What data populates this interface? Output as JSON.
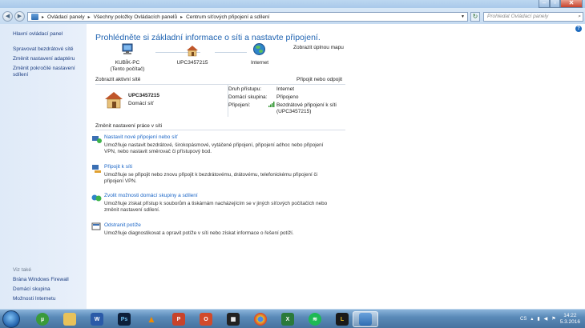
{
  "breadcrumb": [
    "Ovládací panely",
    "Všechny položky Ovládacích panelů",
    "Centrum síťových připojení a sdílení"
  ],
  "search_placeholder": "Prohledat Ovládací panely",
  "sidebar": {
    "items": [
      "Hlavní ovládací panel",
      "Spravovat bezdrátové sítě",
      "Změnit nastavení adaptéru",
      "Změnit pokročilé nastavení",
      "sdílení"
    ],
    "see_also": "Viz také",
    "see_links": [
      "Brána Windows Firewall",
      "Domácí skupina",
      "Možnosti Internetu"
    ]
  },
  "main": {
    "heading": "Prohlédněte si základní informace o síti a nastavte připojení.",
    "full_map": "Zobrazit úplnou mapu",
    "nodes": [
      {
        "label": "KUBÍK-PC",
        "sub": "(Tento počítač)"
      },
      {
        "label": "UPC3457215",
        "sub": ""
      },
      {
        "label": "Internet",
        "sub": ""
      }
    ],
    "active_title": "Zobrazit aktivní sítě",
    "connect_link": "Připojit nebo odpojit",
    "network_name": "UPC3457215",
    "network_type": "Domácí síť",
    "access_label": "Druh přístupu:",
    "access_value": "Internet",
    "homegroup_label": "Domácí skupina:",
    "homegroup_value": "Připojeno",
    "connections_label": "Připojení:",
    "connections_value1": "Bezdrátové připojení k síti",
    "connections_value2": "(UPC3457215)",
    "change_title": "Změnit nastavení práce v síti",
    "tasks": [
      {
        "title": "Nastavit nové připojení nebo síť",
        "desc1": "Umožňuje nastavit bezdrátové, širokopásmové, vytáčené připojení, připojení adhoc nebo připojení",
        "desc2": "VPN, nebo nastavit směrovač či přístupový bod."
      },
      {
        "title": "Připojit k síti",
        "desc1": "Umožňuje se připojit nebo znovu připojit k bezdrátovému, drátovému, telefonickému připojení či",
        "desc2": "připojení VPN."
      },
      {
        "title": "Zvolit možnosti domácí skupiny a sdílení",
        "desc1": "Umožňuje získat přístup k souborům a tiskárnám nacházejícím se v jiných síťových počítačích nebo",
        "desc2": "změnit nastavení sdílení."
      },
      {
        "title": "Odstranit potíže",
        "desc1": "Umožňuje diagnostikovat a opravit potíže v síti nebo získat informace o řešení potíží.",
        "desc2": ""
      }
    ]
  },
  "taskbar": {
    "lang": "CS",
    "time": "14:22",
    "date": "5.3.2016"
  },
  "colors": {
    "link": "#1b66c7",
    "heading": "#1f63b1",
    "sidebar": "#dfeaf8"
  }
}
